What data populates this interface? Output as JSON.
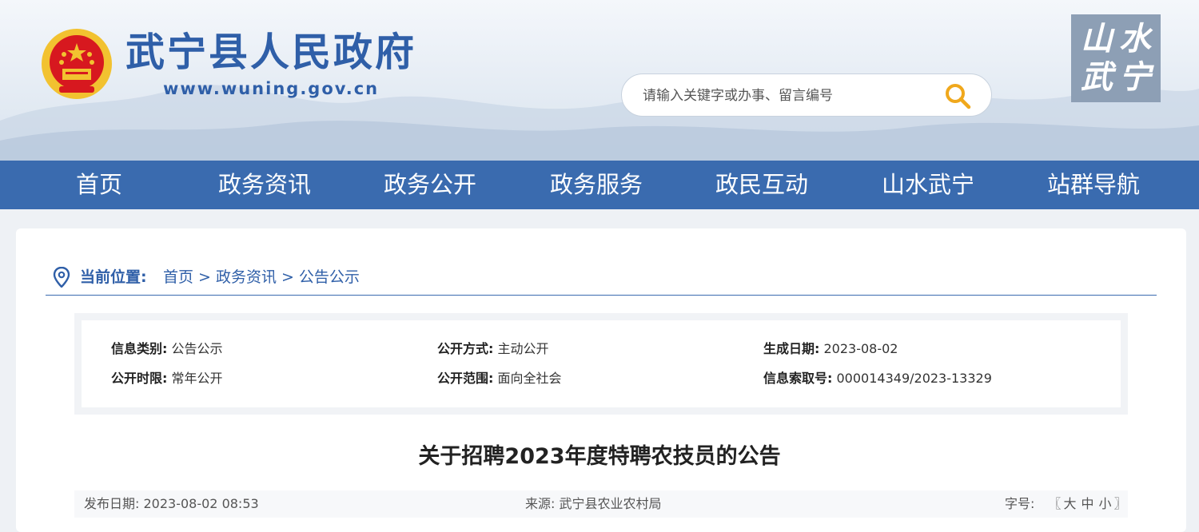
{
  "header": {
    "site_title": "武宁县人民政府",
    "site_url": "www.wuning.gov.cn",
    "search_placeholder": "请输入关键字或办事、留言编号",
    "stamp_chars": [
      "山",
      "水",
      "武",
      "宁"
    ]
  },
  "nav": {
    "items": [
      {
        "label": "首页"
      },
      {
        "label": "政务资讯"
      },
      {
        "label": "政务公开"
      },
      {
        "label": "政务服务"
      },
      {
        "label": "政民互动"
      },
      {
        "label": "山水武宁"
      },
      {
        "label": "站群导航"
      }
    ]
  },
  "breadcrumb": {
    "lead": "当前位置:",
    "items": [
      "首页",
      "政务资讯",
      "公告公示"
    ],
    "separator": ">"
  },
  "meta": {
    "category_label": "信息类别:",
    "category_value": "公告公示",
    "mode_label": "公开方式:",
    "mode_value": "主动公开",
    "date_label": "生成日期:",
    "date_value": "2023-08-02",
    "period_label": "公开时限:",
    "period_value": "常年公开",
    "scope_label": "公开范围:",
    "scope_value": "面向全社会",
    "index_label": "信息索取号:",
    "index_value": "000014349/2023-13329"
  },
  "article": {
    "title": "关于招聘2023年度特聘农技员的公告",
    "pub_date_label": "发布日期:",
    "pub_date_value": "2023-08-02 08:53",
    "source_label": "来源:",
    "source_value": "武宁县农业农村局",
    "font_size_label": "字号:",
    "font_open": "〖",
    "font_large": "大",
    "font_medium": "中",
    "font_small": "小",
    "font_close": "〗"
  },
  "colors": {
    "brand_blue": "#2f5fa8",
    "nav_blue": "#3a6baf",
    "search_icon": "#f0a81c",
    "emblem_red": "#d7181f",
    "emblem_gold": "#f2c230"
  }
}
